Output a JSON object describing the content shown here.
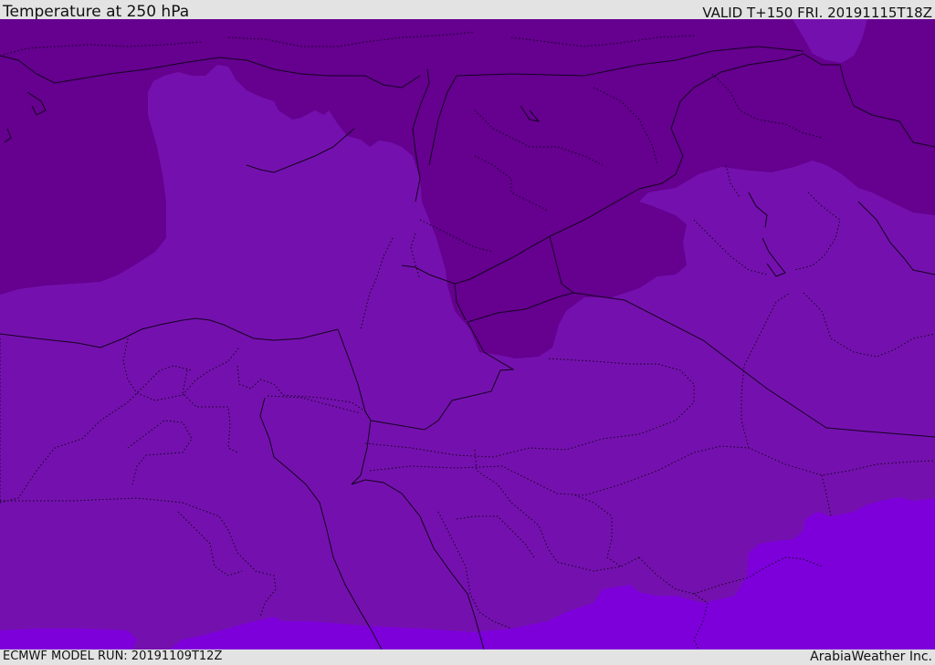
{
  "header": {
    "title": "Temperature at 250 hPa",
    "valid": "VALID T+150 FRI. 20191115T18Z"
  },
  "footer": {
    "model_run": "ECMWF MODEL RUN: 20191109T12Z",
    "credit": "ArabiaWeather Inc."
  },
  "map": {
    "colors": {
      "dark_band": "#65008f",
      "mid_band": "#7411ae",
      "bright_band": "#7d00db",
      "boundary_line": "#15001f"
    }
  }
}
